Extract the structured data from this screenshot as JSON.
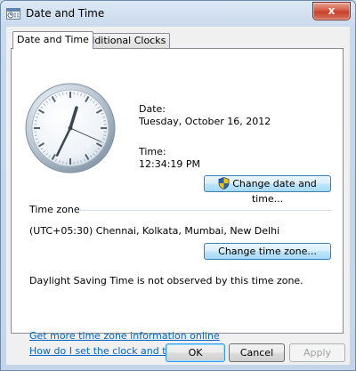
{
  "window": {
    "title": "Date and Time",
    "close_glyph": "x"
  },
  "tabs": [
    {
      "label": "Date and Time",
      "selected": true
    },
    {
      "label": "Additional Clocks",
      "selected": false
    }
  ],
  "date": {
    "label": "Date:",
    "value": "Tuesday, October 16, 2012"
  },
  "time": {
    "label": "Time:",
    "value": "12:34:19 PM"
  },
  "change_date_button": {
    "label": "Change date and time...",
    "icon": "uac-shield-icon"
  },
  "time_zone": {
    "group_label": "Time zone",
    "value": "(UTC+05:30) Chennai, Kolkata, Mumbai, New Delhi",
    "change_button": "Change time zone...",
    "dst_note": "Daylight Saving Time is not observed by this time zone."
  },
  "links": {
    "more_info": "Get more time zone information online",
    "how_to": "How do I set the clock and time zone?"
  },
  "footer": {
    "ok": "OK",
    "cancel": "Cancel",
    "apply": "Apply",
    "apply_enabled": false
  },
  "colors": {
    "link": "#0066cc",
    "close": "#c7402b",
    "frame": "#c4d5ea"
  }
}
